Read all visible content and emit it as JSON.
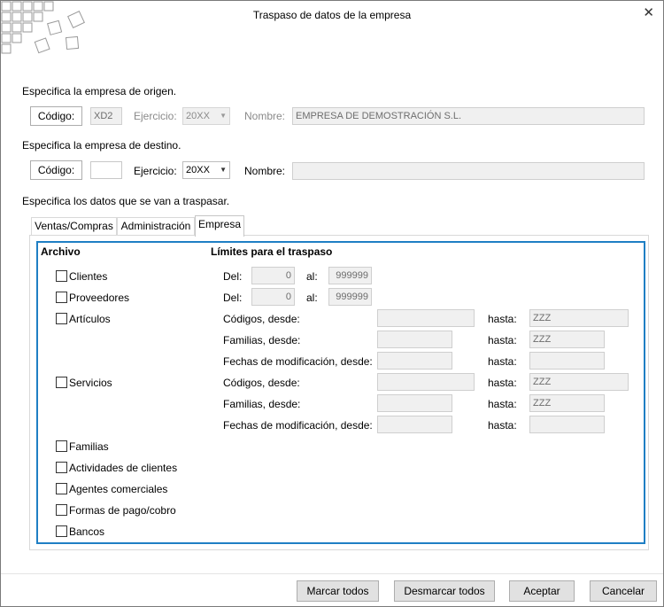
{
  "window": {
    "title": "Traspaso de datos de la empresa",
    "close_glyph": "✕"
  },
  "origen": {
    "heading": "Especifica  la empresa de origen.",
    "codigo_button": "Código:",
    "codigo_value": "XD2",
    "ejercicio_label": "Ejercicio:",
    "ejercicio_value": "20XX",
    "nombre_label": "Nombre:",
    "nombre_value": "EMPRESA DE DEMOSTRACIÓN S.L."
  },
  "destino": {
    "heading": "Especifica la empresa de destino.",
    "codigo_button": "Código:",
    "codigo_value": "",
    "ejercicio_label": "Ejercicio:",
    "ejercicio_value": "20XX",
    "nombre_label": "Nombre:",
    "nombre_value": ""
  },
  "datos_heading": "Especifica los datos que se van a traspasar.",
  "tabs": [
    {
      "label": "Ventas/Compras"
    },
    {
      "label": "Administración"
    },
    {
      "label": "Empresa",
      "active": true
    }
  ],
  "archivo": {
    "header": "Archivo",
    "items": [
      {
        "label": "Clientes",
        "checked": false
      },
      {
        "label": "Proveedores",
        "checked": false
      },
      {
        "label": "Artículos",
        "checked": false
      },
      {
        "label": "Servicios",
        "checked": false
      },
      {
        "label": "Familias",
        "checked": false
      },
      {
        "label": "Actividades de clientes",
        "checked": false
      },
      {
        "label": "Agentes comerciales",
        "checked": false
      },
      {
        "label": "Formas de pago/cobro",
        "checked": false
      },
      {
        "label": "Bancos",
        "checked": false
      }
    ]
  },
  "limites": {
    "header": "Límites para el traspaso",
    "clientes": {
      "del_label": "Del:",
      "del_value": "0",
      "al_label": "al:",
      "al_value": "999999"
    },
    "proveedores": {
      "del_label": "Del:",
      "del_value": "0",
      "al_label": "al:",
      "al_value": "999999"
    },
    "articulos": {
      "codigos_label": "Códigos, desde:",
      "codigos_desde": "",
      "codigos_hasta_label": "hasta:",
      "codigos_hasta": "ZZZ",
      "familias_label": "Familias, desde:",
      "familias_desde": "",
      "familias_hasta_label": "hasta:",
      "familias_hasta": "ZZZ",
      "fechas_label": "Fechas de modificación, desde:",
      "fechas_desde": "",
      "fechas_hasta_label": "hasta:",
      "fechas_hasta": ""
    },
    "servicios": {
      "codigos_label": "Códigos, desde:",
      "codigos_desde": "",
      "codigos_hasta_label": "hasta:",
      "codigos_hasta": "ZZZ",
      "familias_label": "Familias, desde:",
      "familias_desde": "",
      "familias_hasta_label": "hasta:",
      "familias_hasta": "ZZZ",
      "fechas_label": "Fechas de modificación, desde:",
      "fechas_desde": "",
      "fechas_hasta_label": "hasta:",
      "fechas_hasta": ""
    }
  },
  "footer": {
    "marcar": "Marcar todos",
    "desmarcar": "Desmarcar todos",
    "aceptar": "Aceptar",
    "cancelar": "Cancelar"
  },
  "colors": {
    "group_border": "#1f7fc4",
    "disabled_bg": "#f0f0f0",
    "button_bg": "#e1e1e1"
  },
  "icons": {
    "logo": "stacked-squares-logo-icon",
    "close": "close-icon",
    "dropdown": "chevron-down-icon"
  }
}
